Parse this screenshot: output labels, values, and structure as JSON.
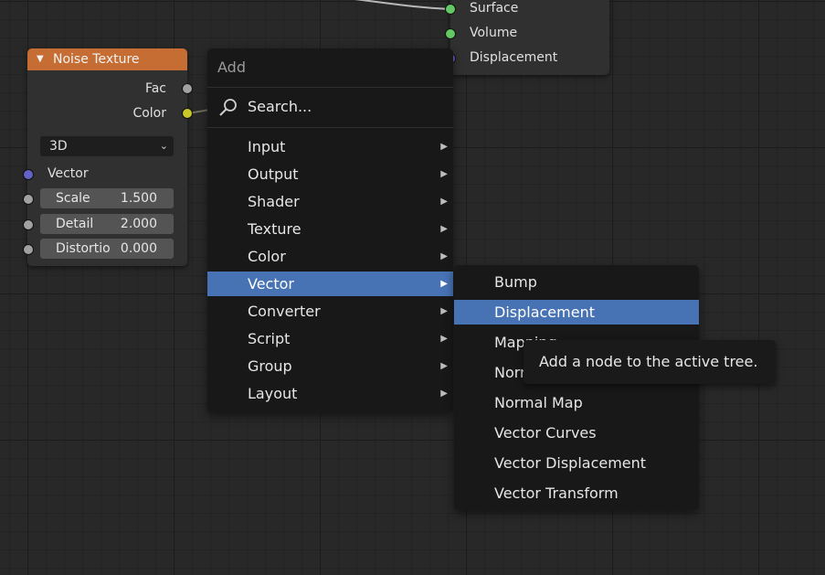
{
  "noise_node": {
    "title": "Noise Texture",
    "outputs": {
      "fac": "Fac",
      "color": "Color"
    },
    "dimension": "3D",
    "vector_label": "Vector",
    "fields": [
      {
        "label": "Scale",
        "value": "1.500"
      },
      {
        "label": "Detail",
        "value": "2.000"
      },
      {
        "label": "Distortio",
        "value": "0.000"
      }
    ]
  },
  "output_node": {
    "inputs": [
      "Surface",
      "Volume",
      "Displacement"
    ]
  },
  "add_menu": {
    "title": "Add",
    "search": "Search...",
    "items": [
      "Input",
      "Output",
      "Shader",
      "Texture",
      "Color",
      "Vector",
      "Converter",
      "Script",
      "Group",
      "Layout"
    ],
    "active": "Vector"
  },
  "vector_submenu": {
    "items": [
      "Bump",
      "Displacement",
      "Mapping",
      "Normal",
      "Normal Map",
      "Vector Curves",
      "Vector Displacement",
      "Vector Transform"
    ],
    "active": "Displacement"
  },
  "tooltip": {
    "text": "Add a node to the active tree."
  },
  "colors": {
    "node_header": "#c66d33",
    "highlight": "#4772b3",
    "socket_color": "#c7c729",
    "socket_vector": "#6363c7",
    "socket_gray": "#a1a1a1",
    "socket_shader": "#63c763"
  }
}
